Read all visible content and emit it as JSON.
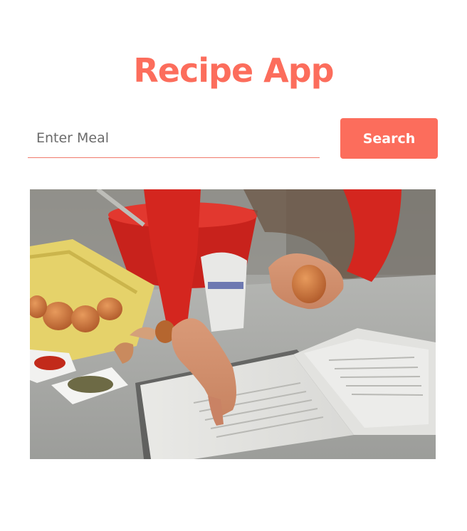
{
  "app": {
    "title": "Recipe App"
  },
  "search": {
    "placeholder": "Enter Meal",
    "value": "",
    "button_label": "Search"
  },
  "hero_image": {
    "description_icon": "cooking-photo"
  },
  "colors": {
    "accent": "#fc6d5c",
    "background": "#ffffff"
  }
}
